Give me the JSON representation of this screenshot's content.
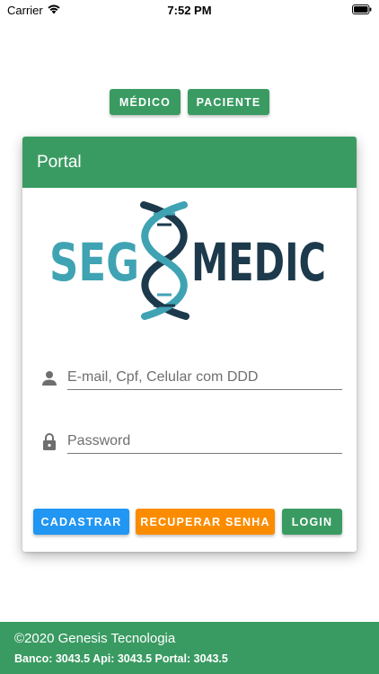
{
  "status_bar": {
    "carrier": "Carrier",
    "time": "7:52 PM"
  },
  "roles": {
    "medico": "MÉDICO",
    "paciente": "PACIENTE"
  },
  "card": {
    "title": "Portal",
    "logo": {
      "left_text": "SEG",
      "right_text": "MEDIC"
    },
    "email_placeholder": "E-mail, Cpf, Celular com DDD",
    "password_placeholder": "Password",
    "buttons": {
      "cadastrar": "CADASTRAR",
      "recuperar": "RECUPERAR SENHA",
      "login": "LOGIN"
    }
  },
  "footer": {
    "copyright": "©2020 Genesis Tecnologia",
    "versions": "Banco: 3043.5 Api: 3043.5 Portal: 3043.5"
  },
  "colors": {
    "primary": "#3a9b62",
    "blue": "#2196f3",
    "orange": "#fb8c00",
    "logo_teal": "#3fa3b3",
    "logo_navy": "#1d3a4c"
  },
  "icons": [
    "wifi-icon",
    "battery-icon",
    "person-icon",
    "lock-icon",
    "dna-icon"
  ]
}
